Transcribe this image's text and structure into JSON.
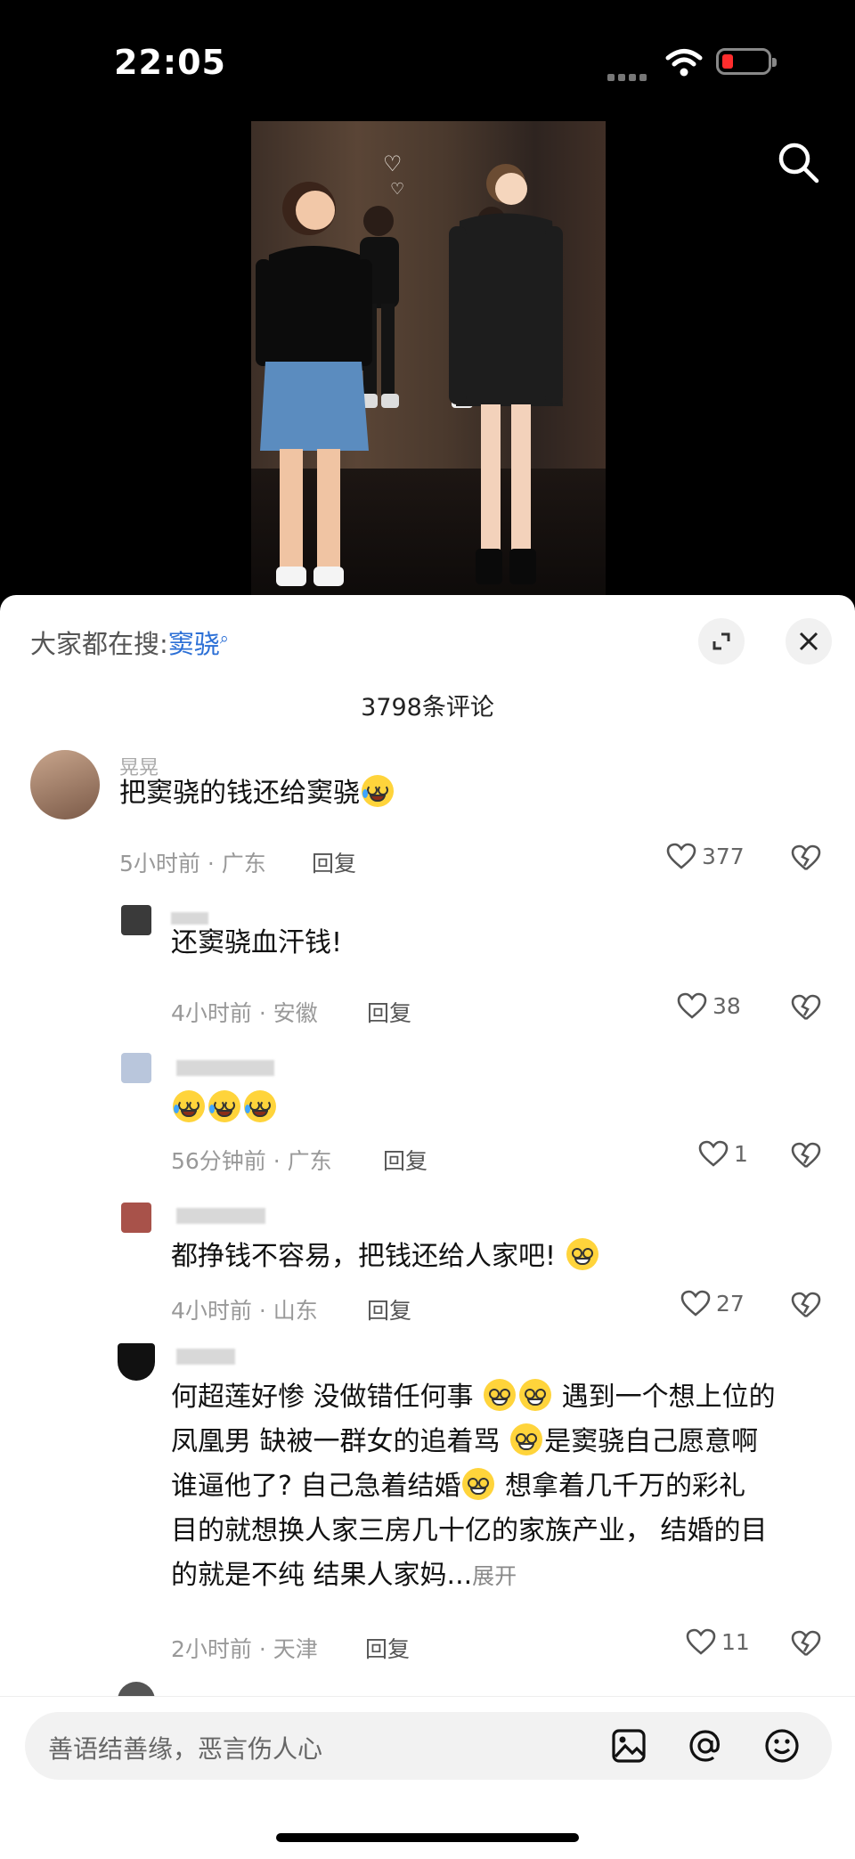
{
  "status": {
    "time": "22:05"
  },
  "video": {
    "alt": ""
  },
  "sheet": {
    "trend_prefix": "大家都在搜:",
    "trend_keyword": "窦骁",
    "comment_count": "3798条评论"
  },
  "comments": [
    {
      "name": "晃晃",
      "text": "把窦骁的钱还给窦骁",
      "meta": "5小时前 · 广东",
      "reply": "回复",
      "likes": "377"
    },
    {
      "text": "还窦骁血汗钱!",
      "meta": "4小时前 · 安徽",
      "reply": "回复",
      "likes": "38"
    },
    {
      "text": "",
      "meta": "56分钟前 · 广东",
      "reply": "回复",
      "likes": "1"
    },
    {
      "text": "都挣钱不容易，把钱还给人家吧!",
      "meta": "4小时前 · 山东",
      "reply": "回复",
      "likes": "27"
    },
    {
      "line1a": "何超莲好惨 没做错任何事",
      "line1b": "遇到一个想上位的",
      "line2a": "凤凰男 缺被一群女的追着骂",
      "line2b": "是窦骁自己愿意啊",
      "line3a": "谁逼他了? 自己急着结婚",
      "line3b": "想拿着几千万的彩礼",
      "line4": "目的就想换人家三房几十亿的家族产业，  结婚的目",
      "line5": "的就是不纯  结果人家妈...",
      "expand": "展开",
      "meta": "2小时前 · 天津",
      "reply": "回复",
      "likes": "11"
    }
  ],
  "input": {
    "placeholder": "善语结善缘，恶言伤人心"
  }
}
